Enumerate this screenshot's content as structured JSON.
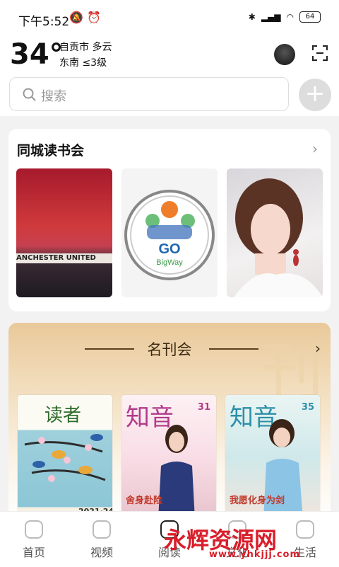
{
  "status": {
    "time": "下午5:52",
    "battery": "64"
  },
  "weather": {
    "temperature": "34°",
    "location": "自贡市 多云",
    "wind": "东南 ≤3级"
  },
  "search": {
    "placeholder": "搜索"
  },
  "book_club": {
    "title": "同城读书会",
    "thumbs": [
      {
        "caption": "ANCHESTER UNITED"
      },
      {
        "caption": "GO BigWay"
      },
      {
        "caption": ""
      }
    ]
  },
  "magazines": {
    "title": "名刊会",
    "watermark": "刊",
    "items": [
      {
        "name": "读者",
        "issue": "2021·24"
      },
      {
        "name": "知音",
        "issue": "31",
        "headline": "舍身赴险"
      },
      {
        "name": "知音",
        "issue": "35",
        "headline": "我愿化身为剑"
      }
    ]
  },
  "tabs": [
    {
      "label": "首页"
    },
    {
      "label": "视频"
    },
    {
      "label": "阅读"
    },
    {
      "label": "文化"
    },
    {
      "label": "生活"
    }
  ],
  "watermark": {
    "text": "永辉资源网",
    "url": "www.yhkjjj.com"
  },
  "colors": {
    "accent_red": "#d81e2a",
    "card_gold": "#e9c99a"
  }
}
